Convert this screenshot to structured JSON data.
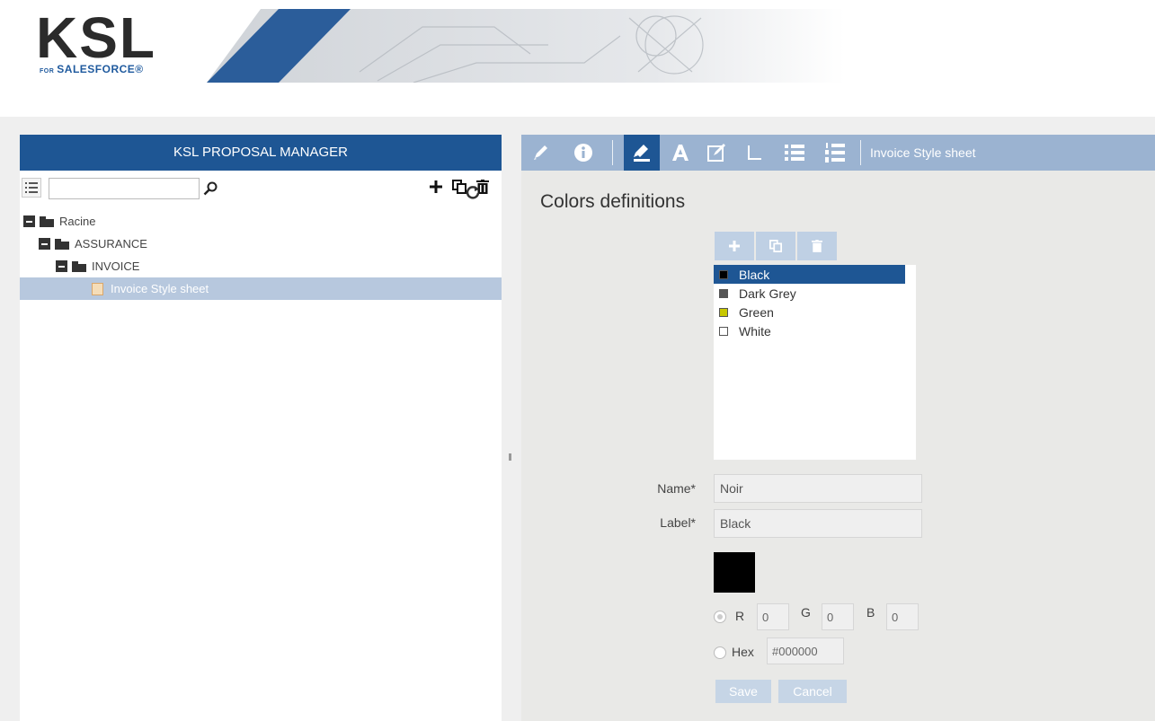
{
  "brand": {
    "logo_text": "KSL",
    "logo_sub_small": "FOR",
    "logo_sub": "SALESFORCE®",
    "accent": "#1e5694"
  },
  "left": {
    "header": "KSL PROPOSAL MANAGER",
    "search": {
      "value": "",
      "placeholder": ""
    },
    "icons": [
      "list-icon",
      "search-icon",
      "add-icon",
      "copy-icon",
      "delete-icon",
      "refresh-icon"
    ],
    "tree": [
      {
        "label": "Racine",
        "level": 0,
        "type": "folder"
      },
      {
        "label": "ASSURANCE",
        "level": 1,
        "type": "folder"
      },
      {
        "label": "INVOICE",
        "level": 2,
        "type": "folder"
      },
      {
        "label": "Invoice Style sheet",
        "level": 3,
        "type": "sheet",
        "selected": true
      }
    ]
  },
  "right": {
    "toolbar_title": "Invoice Style sheet",
    "toolbar_icons": [
      "pencil-icon",
      "info-icon",
      "style-icon",
      "font-icon",
      "edit-box-icon",
      "corner-icon",
      "bullet-list-icon",
      "numbered-list-icon"
    ],
    "section_title": "Colors definitions",
    "colors": [
      {
        "label": "Black",
        "swatch": "#000000",
        "selected": true
      },
      {
        "label": "Dark Grey",
        "swatch": "#555555"
      },
      {
        "label": "Green",
        "swatch": "#c8c800"
      },
      {
        "label": "White",
        "swatch": "#ffffff"
      }
    ],
    "form": {
      "name_label": "Name*",
      "name_value": "Noir",
      "label_label": "Label*",
      "label_value": "Black",
      "preview_color": "#000000",
      "r_label": "R",
      "r_value": "0",
      "g_label": "G",
      "g_value": "0",
      "b_label": "B",
      "b_value": "0",
      "hex_label": "Hex",
      "hex_value": "#000000",
      "save": "Save",
      "cancel": "Cancel"
    }
  }
}
